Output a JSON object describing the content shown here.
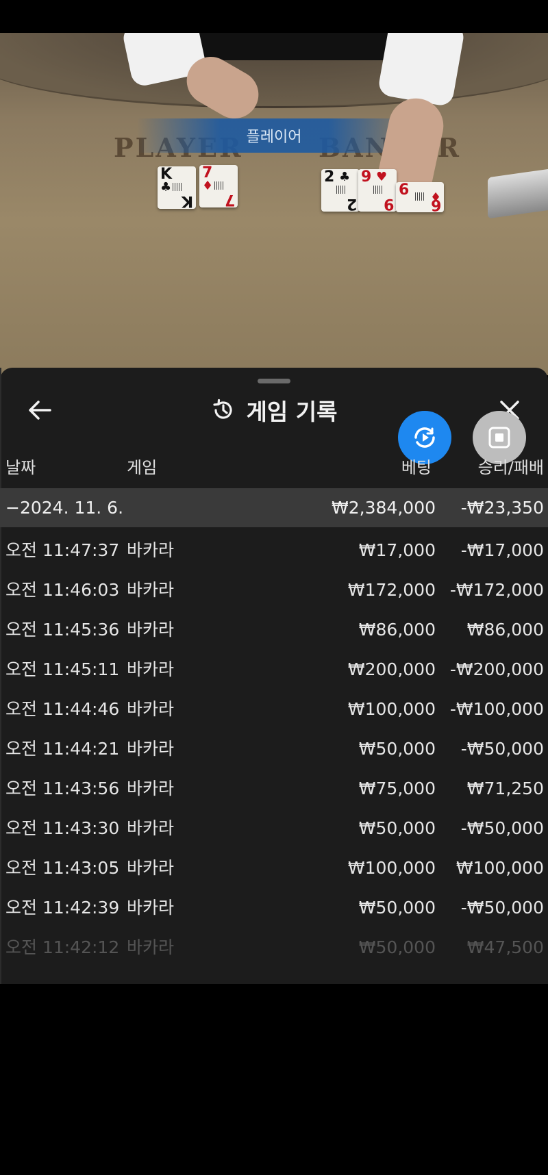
{
  "video": {
    "banner_text": "플레이어",
    "player_label": "PLAYER",
    "banker_label": "BANKER",
    "player_cards": [
      {
        "rank": "K",
        "suit": "♣",
        "color": "black"
      },
      {
        "rank": "7",
        "suit": "♦",
        "color": "red"
      }
    ],
    "banker_cards": [
      {
        "rank": "2",
        "suit": "♣",
        "color": "black"
      },
      {
        "rank": "9",
        "suit": "♥",
        "color": "red"
      },
      {
        "rank": "6",
        "suit": "♦",
        "color": "red"
      }
    ]
  },
  "header": {
    "title": "게임 기록",
    "back_icon": "arrow-left-icon",
    "history_icon": "history-icon",
    "close_icon": "close-icon"
  },
  "columns": {
    "date": "날짜",
    "game": "게임",
    "bet": "베팅",
    "result": "승리/패배"
  },
  "summary": {
    "date": "−2024. 11. 6.",
    "bet": "₩2,384,000",
    "result": "-₩23,350"
  },
  "rows": [
    {
      "time": "오전 11:47:37",
      "game": "바카라",
      "bet": "₩17,000",
      "result": "-₩17,000"
    },
    {
      "time": "오전 11:46:03",
      "game": "바카라",
      "bet": "₩172,000",
      "result": "-₩172,000"
    },
    {
      "time": "오전 11:45:36",
      "game": "바카라",
      "bet": "₩86,000",
      "result": "₩86,000"
    },
    {
      "time": "오전 11:45:11",
      "game": "바카라",
      "bet": "₩200,000",
      "result": "-₩200,000"
    },
    {
      "time": "오전 11:44:46",
      "game": "바카라",
      "bet": "₩100,000",
      "result": "-₩100,000"
    },
    {
      "time": "오전 11:44:21",
      "game": "바카라",
      "bet": "₩50,000",
      "result": "-₩50,000"
    },
    {
      "time": "오전 11:43:56",
      "game": "바카라",
      "bet": "₩75,000",
      "result": "₩71,250"
    },
    {
      "time": "오전 11:43:30",
      "game": "바카라",
      "bet": "₩50,000",
      "result": "-₩50,000"
    },
    {
      "time": "오전 11:43:05",
      "game": "바카라",
      "bet": "₩100,000",
      "result": "₩100,000"
    },
    {
      "time": "오전 11:42:39",
      "game": "바카라",
      "bet": "₩50,000",
      "result": "-₩50,000"
    },
    {
      "time": "오전 11:42:12",
      "game": "바카라",
      "bet": "₩50,000",
      "result": "₩47,500"
    }
  ],
  "colors": {
    "panel_bg": "#1c1c1c",
    "summary_bg": "#3a3a3a",
    "fab_blue": "#1e88f0",
    "fab_gray": "#bdbdbd"
  },
  "fabs": {
    "replay_icon": "replay-icon",
    "stop_icon": "stop-icon"
  }
}
